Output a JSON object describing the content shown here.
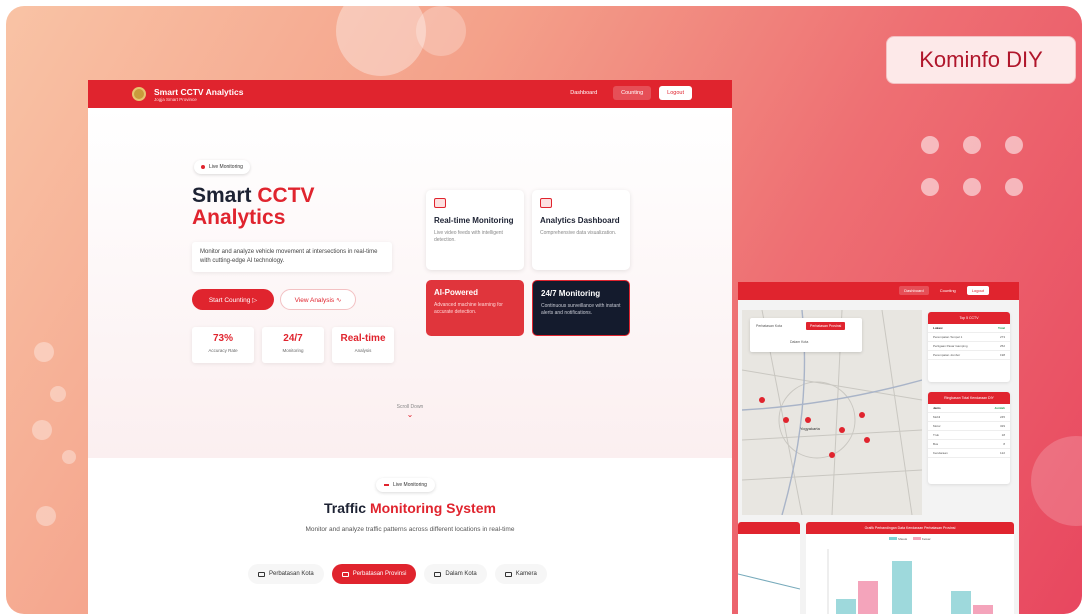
{
  "badge": "Kominfo DIY",
  "app": {
    "title": "Smart CCTV Analytics",
    "subtitle": "Jogja Smart Province",
    "nav": [
      "Dashboard",
      "Counting",
      "Logout"
    ]
  },
  "hero": {
    "live_label": "Live Monitoring",
    "title_part1": "Smart ",
    "title_part2": "CCTV",
    "title_line2": "Analytics",
    "description": "Monitor and analyze vehicle movement at intersections in real-time with cutting-edge AI technology.",
    "start_button": "Start Counting ▷",
    "view_button": "View Analysis ∿",
    "stats": [
      {
        "value": "73%",
        "label": "Accuracy Rate"
      },
      {
        "value": "24/7",
        "label": "Monitoring"
      },
      {
        "value": "Real-time",
        "label": "Analysis"
      }
    ],
    "features": [
      {
        "title": "Real-time Monitoring",
        "desc": "Live video feeds with intelligent detection."
      },
      {
        "title": "Analytics Dashboard",
        "desc": "Comprehensive data visualization."
      },
      {
        "title": "AI-Powered",
        "desc": "Advanced machine learning for accurate detection."
      },
      {
        "title": "24/7 Monitoring",
        "desc": "Continuous surveillance with instant alerts and notifications."
      }
    ],
    "scroll_label": "Scroll Down"
  },
  "section": {
    "live_label": "Live Monitoring",
    "title_part1": "Traffic ",
    "title_part2": "Monitoring System",
    "subtitle": "Monitor and analyze traffic patterns across different locations in real-time",
    "tabs": [
      "Perbatasan Kota",
      "Perbatasan Provinsi",
      "Dalam Kota",
      "Kamera"
    ]
  },
  "dashboard2": {
    "nav": [
      "Dashboard",
      "Counting",
      "Logout"
    ],
    "map_buttons": [
      "Perbatasan Kota",
      "Perbatasan Provinsi",
      "Dalam Kota"
    ],
    "map_label": "Yogyakarta",
    "panel1_title": "Top 5 CCTV",
    "panel1_header": [
      "Lokasi",
      "Total"
    ],
    "panel1_rows": [
      [
        "Perempatan Tempel 1",
        "273"
      ],
      [
        "Pertigaan Pasar Gamping",
        "252"
      ],
      [
        "Perempatan Jombor",
        "198"
      ]
    ],
    "panel2_title": "Ringkasan Total Kendaraan DIY",
    "panel2_header": [
      "Jenis",
      "Jumlah"
    ],
    "panel2_rows": [
      [
        "Mobil",
        "245"
      ],
      [
        "Motor",
        "329"
      ],
      [
        "Truk",
        "18"
      ],
      [
        "Bus",
        "8"
      ],
      [
        "Kendaraan",
        "122"
      ]
    ],
    "chart_title": "Grafik Perbandingan Data Kendaraan Perbatasan Provinsi",
    "legend": [
      "Masuk",
      "Keluar"
    ]
  }
}
